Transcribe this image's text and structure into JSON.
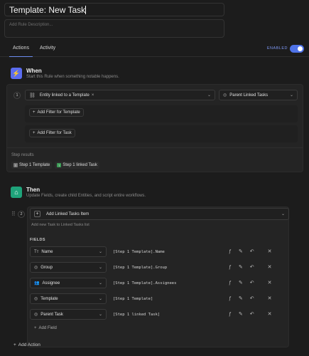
{
  "header": {
    "title": "Template: New Task",
    "description_placeholder": "Add Rule Description..."
  },
  "tabs": [
    {
      "label": "Actions",
      "active": true
    },
    {
      "label": "Activity",
      "active": false
    }
  ],
  "status": {
    "label": "ENABLED",
    "enabled": true,
    "accent": "#4f73e8"
  },
  "when": {
    "title": "When",
    "subtitle": "Start this Rule when something notable happens.",
    "icon": "lightning-icon",
    "icon_color": "#5b6cf0",
    "step_number": "1",
    "trigger": "Entity linked to a Template",
    "trigger_target": "Parent Linked Tasks",
    "filters": [
      "Add Filter for Template",
      "Add Filter for Task"
    ],
    "step_results_label": "Step results",
    "step_results": [
      "Step 1 Template",
      "Step 1 linked Task"
    ]
  },
  "then": {
    "title": "Then",
    "subtitle": "Update Fields, create child Entities, and script entire workflows.",
    "icon": "robot-icon",
    "icon_color": "#1fa37a",
    "step_number": "2",
    "action": "Add Linked Tasks Item",
    "action_desc": "Add new Task to Linked Tasks list",
    "fields_label": "FIELDS",
    "fields": [
      {
        "name": "Name",
        "icon": "text-icon",
        "value": "[Step 1 Template].Name"
      },
      {
        "name": "Group",
        "icon": "circle-arrow-icon",
        "value": "[Step 1 Template].Group"
      },
      {
        "name": "Assignee",
        "icon": "users-icon",
        "value": "[Step 1 Template].Assignees"
      },
      {
        "name": "Template",
        "icon": "circle-arrow-icon",
        "value": "[Step 1 Template]"
      },
      {
        "name": "Parent Task",
        "icon": "circle-arrow-icon",
        "value": "[Step 1 linked Task]"
      }
    ],
    "add_field_label": "Add Field"
  },
  "footer": {
    "add_action_label": "Add Action"
  }
}
